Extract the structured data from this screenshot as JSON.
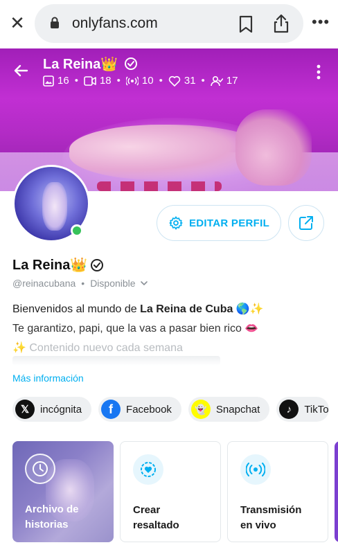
{
  "browser": {
    "url": "onlyfans.com",
    "close_label": "✕",
    "more_label": "•••"
  },
  "banner": {
    "name": "La Reina👑",
    "stats": {
      "photos": "16",
      "videos": "18",
      "streams": "10",
      "likes": "31",
      "fans": "17"
    }
  },
  "actions": {
    "edit_profile_label": "EDITAR PERFIL"
  },
  "profile": {
    "name": "La Reina👑",
    "handle": "@reinacubana",
    "separator": "•",
    "status": "Disponible",
    "bio_line1_prefix": "Bienvenidos al mundo de ",
    "bio_line1_bold": "La Reina de Cuba",
    "bio_line1_suffix": " 🌎✨",
    "bio_line2": "Te garantizo, papi, que la vas a pasar bien rico 👄",
    "bio_line3": "✨ Contenido nuevo cada semana",
    "more_info": "Más información"
  },
  "socials": [
    {
      "label": "incógnita",
      "icon": "x-icon",
      "icon_char": "𝕏",
      "bg": "#111111",
      "fg": "#ffffff"
    },
    {
      "label": "Facebook",
      "icon": "facebook-icon",
      "icon_char": "f",
      "bg": "#1877f2",
      "fg": "#ffffff"
    },
    {
      "label": "Snapchat",
      "icon": "snapchat-icon",
      "icon_char": "👻",
      "bg": "#fffc00",
      "fg": "#111111"
    },
    {
      "label": "TikTo",
      "icon": "tiktok-icon",
      "icon_char": "♪",
      "bg": "#111111",
      "fg": "#ffffff"
    }
  ],
  "cards": {
    "story_archive_line1": "Archivo de",
    "story_archive_line2": "historias",
    "highlight_line1": "Crear",
    "highlight_line2": "resaltado",
    "live_line1": "Transmisión",
    "live_line2": "en vivo"
  },
  "colors": {
    "accent": "#00aff0",
    "online": "#37c25a",
    "banner": "#b22bc5"
  }
}
